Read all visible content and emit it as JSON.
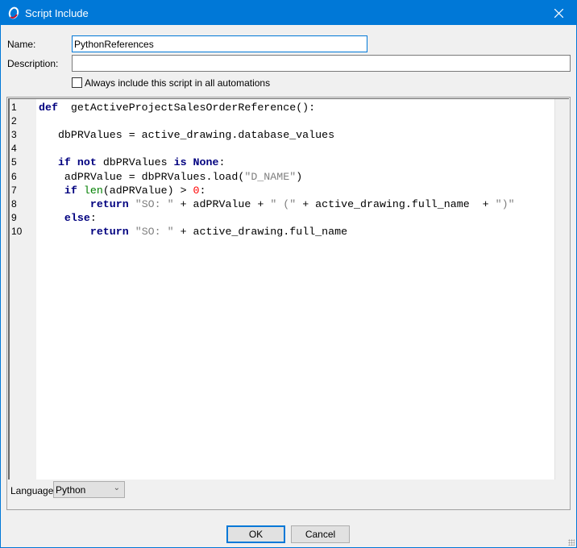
{
  "window": {
    "title": "Script Include",
    "icon": "app-logo-icon",
    "close_icon": "close-icon"
  },
  "form": {
    "name_label": "Name:",
    "name_value": "PythonReferences",
    "description_label": "Description:",
    "description_value": "",
    "always_include_label": "Always include this script in all automations",
    "always_include_checked": false
  },
  "editor": {
    "lines": [
      {
        "n": "1",
        "tokens": [
          [
            "kw",
            "def"
          ],
          [
            "",
            "  getActiveProjectSalesOrderReference():"
          ]
        ]
      },
      {
        "n": "2",
        "tokens": []
      },
      {
        "n": "3",
        "tokens": [
          [
            "",
            "   dbPRValues = active_drawing.database_values"
          ]
        ]
      },
      {
        "n": "4",
        "tokens": []
      },
      {
        "n": "5",
        "tokens": [
          [
            "",
            "   "
          ],
          [
            "kw",
            "if not"
          ],
          [
            "",
            " dbPRValues "
          ],
          [
            "kw",
            "is None"
          ],
          [
            "",
            ":"
          ]
        ]
      },
      {
        "n": "6",
        "tokens": [
          [
            "",
            "    adPRValue = dbPRValues.load("
          ],
          [
            "st",
            "\"D_NAME\""
          ],
          [
            "",
            ")"
          ]
        ]
      },
      {
        "n": "7",
        "tokens": [
          [
            "",
            "    "
          ],
          [
            "kw",
            "if"
          ],
          [
            "",
            " "
          ],
          [
            "bi",
            "len"
          ],
          [
            "",
            "(adPRValue) > "
          ],
          [
            "nm",
            "0"
          ],
          [
            "",
            ":"
          ]
        ]
      },
      {
        "n": "8",
        "tokens": [
          [
            "",
            "        "
          ],
          [
            "kw",
            "return"
          ],
          [
            "",
            " "
          ],
          [
            "st",
            "\"SO: \""
          ],
          [
            "",
            " + adPRValue + "
          ],
          [
            "st",
            "\" (\""
          ],
          [
            "",
            " + active_drawing.full_name  + "
          ],
          [
            "st",
            "\")\""
          ]
        ]
      },
      {
        "n": "9",
        "tokens": [
          [
            "",
            "    "
          ],
          [
            "kw",
            "else"
          ],
          [
            "",
            ":"
          ]
        ]
      },
      {
        "n": "10",
        "tokens": [
          [
            "",
            "        "
          ],
          [
            "kw",
            "return"
          ],
          [
            "",
            " "
          ],
          [
            "st",
            "\"SO: \""
          ],
          [
            "",
            " + active_drawing.full_name"
          ]
        ]
      }
    ]
  },
  "language": {
    "label": "Language",
    "selected": "Python"
  },
  "buttons": {
    "ok": "OK",
    "cancel": "Cancel"
  },
  "colors": {
    "titlebar": "#0078d7",
    "keyword": "#00007f",
    "builtin": "#007f00",
    "string": "#7f7f7f",
    "number": "#ff0000"
  }
}
